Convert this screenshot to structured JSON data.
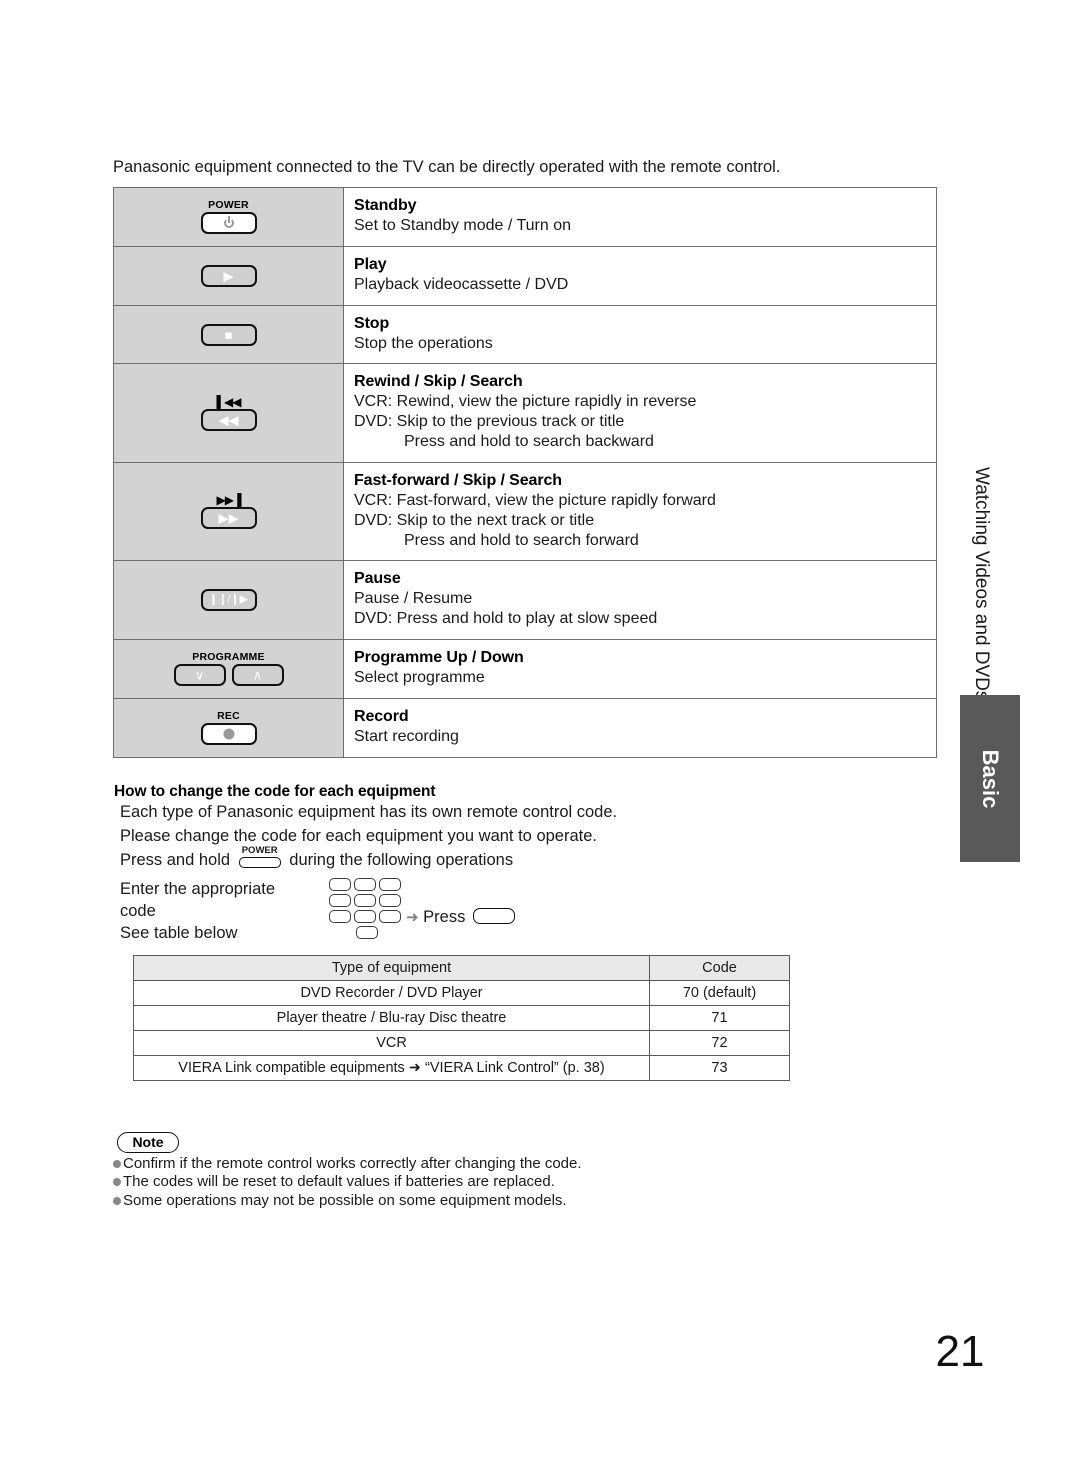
{
  "intro": "Panasonic equipment connected to the TV can be directly operated with the remote control.",
  "remote_table": {
    "rows": [
      {
        "button": {
          "label": "POWER",
          "glyph": "power-symbol",
          "skip_mark": ""
        },
        "title": "Standby",
        "lines": [
          "Set to Standby mode / Turn on"
        ],
        "indented": []
      },
      {
        "button": {
          "label": "",
          "glyph": "▶",
          "skip_mark": ""
        },
        "title": "Play",
        "lines": [
          "Playback videocassette / DVD"
        ],
        "indented": []
      },
      {
        "button": {
          "label": "",
          "glyph": "■",
          "skip_mark": ""
        },
        "title": "Stop",
        "lines": [
          "Stop the operations"
        ],
        "indented": []
      },
      {
        "button": {
          "label": "",
          "glyph": "◀◀",
          "skip_mark": "▌◀◀"
        },
        "title": "Rewind / Skip / Search",
        "lines": [
          "VCR: Rewind, view the picture rapidly in reverse",
          "DVD: Skip to the previous track or title"
        ],
        "indented": [
          "Press and hold to search backward"
        ]
      },
      {
        "button": {
          "label": "",
          "glyph": "▶▶",
          "skip_mark": "▶▶▐"
        },
        "title": "Fast-forward / Skip / Search",
        "lines": [
          "VCR: Fast-forward, view the picture rapidly forward",
          "DVD: Skip to the next track or title"
        ],
        "indented": [
          "Press and hold to search forward"
        ]
      },
      {
        "button": {
          "label": "",
          "glyph": "❙❙/❙▶",
          "skip_mark": ""
        },
        "title": "Pause",
        "lines": [
          "Pause / Resume",
          "DVD: Press and hold to play at slow speed"
        ],
        "indented": []
      },
      {
        "button": {
          "label": "PROGRAMME",
          "glyph": "programme-pair",
          "skip_mark": "",
          "down_glyph": "∨",
          "up_glyph": "∧"
        },
        "title": "Programme Up / Down",
        "lines": [
          "Select programme"
        ],
        "indented": []
      },
      {
        "button": {
          "label": "REC",
          "glyph": "record-dot",
          "skip_mark": ""
        },
        "title": "Record",
        "lines": [
          "Start recording"
        ],
        "indented": []
      }
    ]
  },
  "howto": {
    "heading": "How to change the code for each equipment",
    "line1": "Each type of Panasonic equipment has its own remote control code.",
    "line2": "Please change the code for each equipment you want to operate.",
    "line3_before": "Press and hold",
    "line3_button_label": "POWER",
    "line3_after": "during the following operations",
    "enter_line1": "Enter the appropriate",
    "enter_line2": "code",
    "enter_line3": "See table below",
    "arrow": "➜",
    "press_label": "Press"
  },
  "code_table": {
    "headers": [
      "Type of equipment",
      "Code"
    ],
    "rows": [
      {
        "equipment": "DVD Recorder / DVD Player",
        "code": "70 (default)"
      },
      {
        "equipment": "Player theatre / Blu-ray Disc theatre",
        "code": "71"
      },
      {
        "equipment": "VCR",
        "code": "72"
      },
      {
        "equipment": "VIERA Link compatible equipments ➜ “VIERA Link Control” (p. 38)",
        "code": "73"
      }
    ]
  },
  "note": {
    "badge": "Note",
    "items": [
      "Confirm if the remote control works correctly after changing the code.",
      "The codes will be reset to default values if batteries are replaced.",
      "Some operations may not be possible on some equipment models."
    ]
  },
  "side": {
    "chapter": "Watching Videos and DVDs",
    "tab": "Basic"
  },
  "page_number": "21",
  "colors": {
    "icon_cell_bg": "#d3d3d3",
    "tab_bg": "#595959",
    "table_header_bg": "#e8e8e8",
    "arrow_gray": "#808080"
  }
}
